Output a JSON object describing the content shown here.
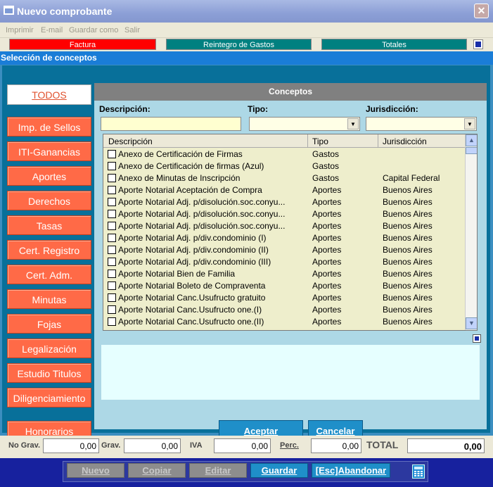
{
  "window": {
    "title": "Nuevo comprobante",
    "close_glyph": "✕"
  },
  "menu": [
    {
      "label": "Imprimir"
    },
    {
      "label": "E-mail"
    },
    {
      "label": "Guardar como"
    },
    {
      "label": "Salir"
    }
  ],
  "doc_tabs": [
    {
      "label": "Factura"
    },
    {
      "label": "Reintegro de Gastos"
    },
    {
      "label": "Totales"
    }
  ],
  "dialog": {
    "title": "Selección de conceptos"
  },
  "sidebar": {
    "todos": "TODOS",
    "items": [
      {
        "label": "Imp. de Sellos"
      },
      {
        "label": "ITI-Ganancias"
      },
      {
        "label": "Aportes"
      },
      {
        "label": "Derechos"
      },
      {
        "label": "Tasas"
      },
      {
        "label": "Cert. Registro"
      },
      {
        "label": "Cert. Adm."
      },
      {
        "label": "Minutas"
      },
      {
        "label": "Fojas"
      },
      {
        "label": "Legalización"
      },
      {
        "label": "Estudio Titulos"
      },
      {
        "label": "Diligenciamiento"
      },
      {
        "label": "Honorarios"
      }
    ]
  },
  "conceptos": {
    "header": "Conceptos",
    "filters": {
      "descripcion_label": "Descripción:",
      "tipo_label": "Tipo:",
      "jurisdiccion_label": "Jurisdicción:",
      "descripcion_value": "",
      "tipo_value": "",
      "jurisdiccion_value": ""
    },
    "columns": [
      "Descripción",
      "Tipo",
      "Jurisdicción"
    ],
    "rows": [
      {
        "descripcion": "Anexo de Certificación de Firmas",
        "tipo": "Gastos",
        "jurisdiccion": ""
      },
      {
        "descripcion": "Anexo de Certificación de firmas (Azul)",
        "tipo": "Gastos",
        "jurisdiccion": ""
      },
      {
        "descripcion": "Anexo de Minutas de Inscripción",
        "tipo": "Gastos",
        "jurisdiccion": "Capital Federal"
      },
      {
        "descripcion": "Aporte Notarial Aceptación de Compra",
        "tipo": "Aportes",
        "jurisdiccion": "Buenos Aires"
      },
      {
        "descripcion": "Aporte Notarial Adj. p/disolución.soc.conyu...",
        "tipo": "Aportes",
        "jurisdiccion": "Buenos Aires"
      },
      {
        "descripcion": "Aporte Notarial Adj. p/disolución.soc.conyu...",
        "tipo": "Aportes",
        "jurisdiccion": "Buenos Aires"
      },
      {
        "descripcion": "Aporte Notarial Adj. p/disolución.soc.conyu...",
        "tipo": "Aportes",
        "jurisdiccion": "Buenos Aires"
      },
      {
        "descripcion": "Aporte Notarial Adj. p/div.condominio (I)",
        "tipo": "Aportes",
        "jurisdiccion": "Buenos Aires"
      },
      {
        "descripcion": "Aporte Notarial Adj. p/div.condominio (II)",
        "tipo": "Aportes",
        "jurisdiccion": "Buenos Aires"
      },
      {
        "descripcion": "Aporte Notarial Adj. p/div.condominio (III)",
        "tipo": "Aportes",
        "jurisdiccion": "Buenos Aires"
      },
      {
        "descripcion": "Aporte Notarial Bien de Familia",
        "tipo": "Aportes",
        "jurisdiccion": "Buenos Aires"
      },
      {
        "descripcion": "Aporte Notarial Boleto de Compraventa",
        "tipo": "Aportes",
        "jurisdiccion": "Buenos Aires"
      },
      {
        "descripcion": "Aporte Notarial Canc.Usufructo gratuito",
        "tipo": "Aportes",
        "jurisdiccion": "Buenos Aires"
      },
      {
        "descripcion": "Aporte Notarial Canc.Usufructo one.(I)",
        "tipo": "Aportes",
        "jurisdiccion": "Buenos Aires"
      },
      {
        "descripcion": "Aporte Notarial Canc.Usufructo one.(II)",
        "tipo": "Aportes",
        "jurisdiccion": "Buenos Aires"
      }
    ],
    "aceptar": "Aceptar",
    "cancelar": "Cancelar"
  },
  "totals": {
    "no_grav_label": "No Grav.",
    "no_grav_value": "0,00",
    "grav_label": "Grav.",
    "grav_value": "0,00",
    "iva_label": "IVA",
    "iva_value": "0,00",
    "perc_label": "Perc.",
    "perc_value": "0,00",
    "total_label": "TOTAL",
    "total_value": "0,00"
  },
  "toolbar": {
    "nuevo": "Nuevo",
    "copiar": "Copiar",
    "editar": "Editar",
    "guardar": "Guardar",
    "abandonar": "[Esc]Abandonar"
  },
  "icons": {
    "app": "window-icon",
    "close": "close-icon",
    "dropdown": "chevron-down-icon",
    "scroll_up": "scroll-up-icon",
    "scroll_down": "scroll-down-icon",
    "calculator": "calculator-icon"
  },
  "colors": {
    "sidebar_button": "#ff6a47",
    "accent_blue": "#1f8fc9",
    "grid_bg": "#eeeecc",
    "toolbar_bg": "#17219e"
  }
}
